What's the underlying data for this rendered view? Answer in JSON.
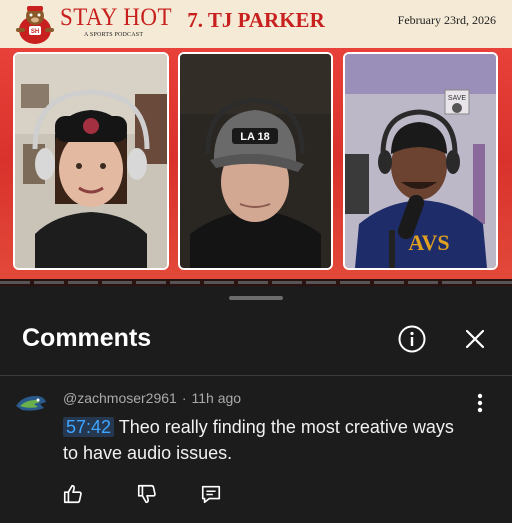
{
  "video": {
    "show_name": "STAY HOT",
    "show_subtitle": "A SPORTS PODCAST",
    "episode_title": "7. TJ PARKER",
    "date": "February 23rd, 2026",
    "cap_text": "LA 18",
    "shirt_text": "AVS",
    "sign_text": "SAVE"
  },
  "sheet": {
    "title": "Comments",
    "info_icon": "info-icon",
    "close_icon": "close-icon"
  },
  "comment": {
    "author": "@zachmoser2961",
    "age": "11h ago",
    "timestamp": "57:42",
    "text": "Theo really finding the most creative ways to have audio issues.",
    "icons": [
      "like-icon",
      "dislike-icon",
      "reply-icon",
      "more-vert-icon"
    ]
  },
  "colors": {
    "accent_red": "#c8201f",
    "link_blue": "#3ea6ff",
    "sheet_bg": "#1c1c1c",
    "meta_gray": "#aaaaaa"
  }
}
